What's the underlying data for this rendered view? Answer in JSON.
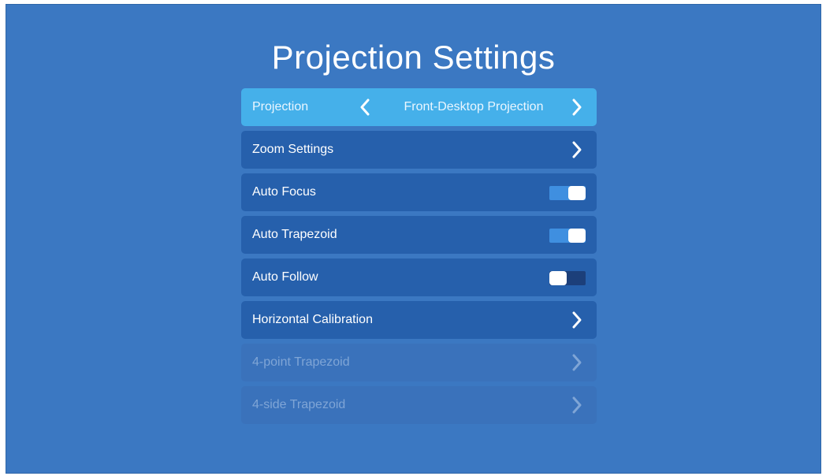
{
  "title": "Projection Settings",
  "colors": {
    "background": "#3b78c2",
    "row": "#2660ac",
    "row_focused": "#45b0ea",
    "row_disabled": "#3a72bb",
    "toggle_on": "#3f8fe0",
    "toggle_off": "#1c3f7a"
  },
  "menu": {
    "projection": {
      "label": "Projection",
      "value": "Front-Desktop Projection",
      "left_icon": "chevron-left-icon",
      "right_icon": "chevron-right-icon",
      "focused": true
    },
    "zoom_settings": {
      "label": "Zoom Settings",
      "icon": "chevron-right-icon"
    },
    "auto_focus": {
      "label": "Auto Focus",
      "toggle": "on"
    },
    "auto_trapezoid": {
      "label": "Auto Trapezoid",
      "toggle": "on"
    },
    "auto_follow": {
      "label": "Auto Follow",
      "toggle": "off"
    },
    "horizontal_calibration": {
      "label": "Horizontal Calibration",
      "icon": "chevron-right-icon"
    },
    "four_point_trapezoid": {
      "label": "4-point Trapezoid",
      "icon": "chevron-right-icon",
      "disabled": true
    },
    "four_side_trapezoid": {
      "label": "4-side Trapezoid",
      "icon": "chevron-right-icon",
      "disabled": true
    }
  }
}
